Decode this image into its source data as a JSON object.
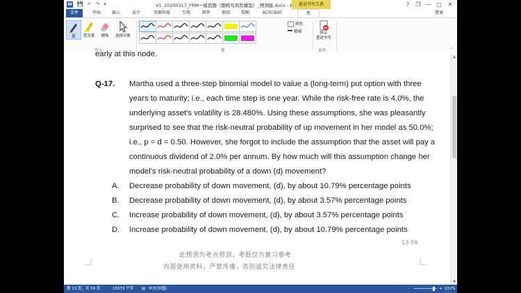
{
  "window": {
    "title": "V1_20200317_FRM一级百题（期权与风险模型）_预测版.docx - Mi...",
    "context_tab": "墨迹书写工具",
    "help": "?",
    "restore": "❐",
    "minimize": "—",
    "maximize": "□",
    "close": "✕"
  },
  "quick_access": {
    "word_letter": "W",
    "save": "💾",
    "undo": "↶",
    "redo": "↷",
    "customize": "▾"
  },
  "tabs": [
    {
      "label": "文件"
    },
    {
      "label": "开始"
    },
    {
      "label": "插入"
    },
    {
      "label": "设计"
    },
    {
      "label": "页面布局"
    },
    {
      "label": "引用"
    },
    {
      "label": "邮件"
    },
    {
      "label": "审阅"
    },
    {
      "label": "视图"
    },
    {
      "label": "ACROBAT"
    },
    {
      "label": "笔"
    }
  ],
  "login_label": "登录",
  "ribbon": {
    "tools": [
      {
        "label": "笔",
        "icon": "pen-icon"
      },
      {
        "label": "荧光笔",
        "icon": "highlighter-icon"
      },
      {
        "label": "擦除",
        "icon": "eraser-icon"
      },
      {
        "label": "选择对象",
        "icon": "select-objects-icon"
      }
    ],
    "group_write": "写入",
    "group_pens": "笔",
    "group_close": "关闭",
    "color_label": "颜色",
    "thickness_label": "粗细",
    "stop_label_1": "停止",
    "stop_label_2": "墨迹书写",
    "pen_styles": [
      {
        "color": "#1b1b1b",
        "type": "line"
      },
      {
        "color": "#d8333a",
        "type": "line"
      },
      {
        "color": "#1b1b1b",
        "type": "line"
      },
      {
        "color": "#1b1b1b",
        "type": "line"
      },
      {
        "color": "#1b1b1b",
        "type": "line"
      },
      {
        "color": "#f0f020",
        "type": "highlighter"
      },
      {
        "color": "#4a7fd4",
        "type": "line"
      },
      {
        "color": "#1b1b1b",
        "type": "line"
      },
      {
        "color": "#d8333a",
        "type": "line"
      },
      {
        "color": "#1b1b1b",
        "type": "line"
      },
      {
        "color": "#1b1b1b",
        "type": "line"
      },
      {
        "color": "#1b1b1b",
        "type": "line"
      },
      {
        "color": "#28e02a",
        "type": "highlighter"
      },
      {
        "color": "#e020e0",
        "type": "highlighter"
      }
    ]
  },
  "document": {
    "cut_line": "early at this node.",
    "question_number": "Q-17.",
    "question_lines": [
      "Martha used a three-step binomial model to value a (long-term) put option with three",
      "years to maturity; i.e., each time step is one year. While the risk-free rate is 4.0%, the",
      "underlying asset's volatility is 28.480%. Using these assumptions, she was pleasantly",
      "surprised to see that the risk-neutral probability of up movement in her model as 50.0%;",
      "i.e., p = d = 0.50. However, she forgot to include the assumption that the asset will pay a",
      "continuous dividend of 2.0% per annum. By how much will this assumption change her",
      "model's risk-neutral probability of a down (d) movement?"
    ],
    "options": [
      {
        "letter": "A.",
        "text": "Decrease probability of down movement, (d), by about 10.79% percentage points"
      },
      {
        "letter": "B.",
        "text": "Decrease probability of down movement, (d), by about 3.57% percentage points"
      },
      {
        "letter": "C.",
        "text": "Increase probability of down movement, (d), by about 3.57% percentage points"
      },
      {
        "letter": "D.",
        "text": "Increase probability of down movement, (d), by about 10.79% percentage points"
      }
    ],
    "page_number": "13-59",
    "watermark_line1": "此预测为考点预测，考题仅为复习参考",
    "watermark_line2": "内部使用资料，严禁传播，否则追究法律责任"
  },
  "status_bar": {
    "page": "第 13 页，共 59 页",
    "words": "15073 个字",
    "language_icon": "▤",
    "language": "中文(中国)",
    "zoom_minus": "-",
    "zoom_plus": "+",
    "zoom": "152%"
  }
}
